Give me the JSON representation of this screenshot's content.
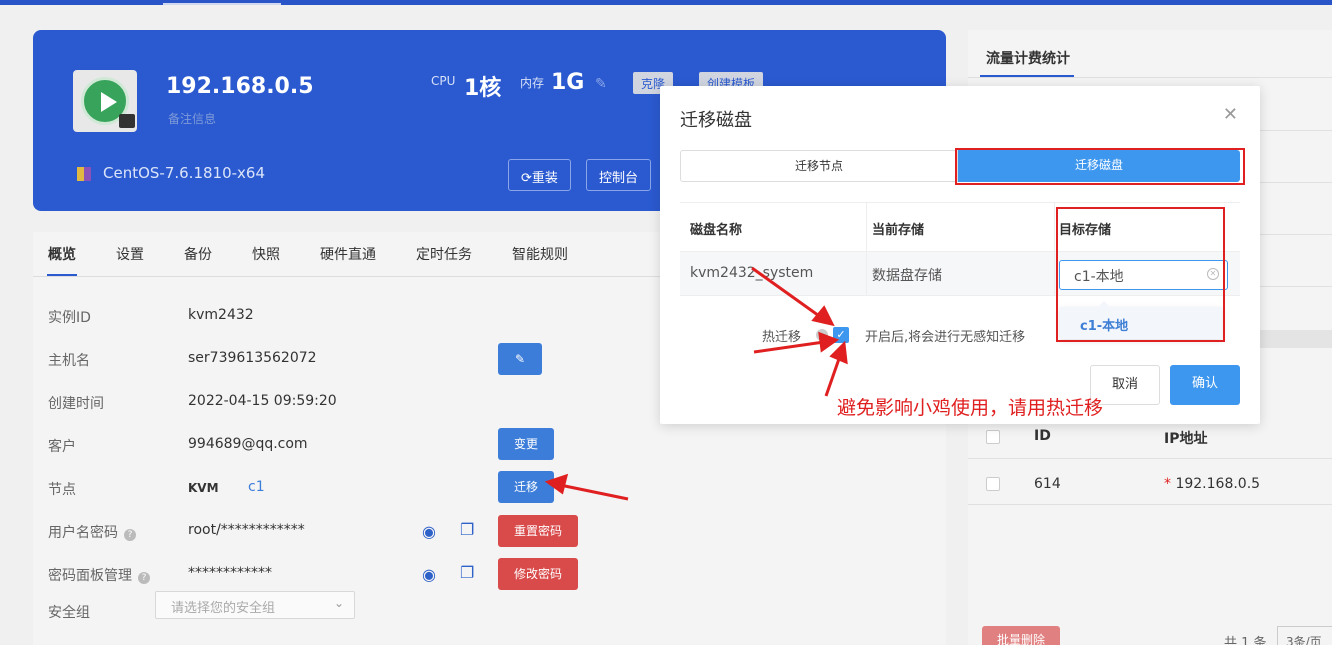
{
  "hero": {
    "ip": "192.168.0.5",
    "remark": "备注信息",
    "cpu_label": "CPU",
    "cpu_value": "1核",
    "mem_label": "内存",
    "mem_value": "1G",
    "pill1": "克隆",
    "pill2": "创建模板",
    "os": "CentOS-7.6.1810-x64",
    "reinstall": "重装",
    "console": "控制台"
  },
  "tabs": [
    "概览",
    "设置",
    "备份",
    "快照",
    "硬件直通",
    "定时任务",
    "智能规则"
  ],
  "info": {
    "instance_id_label": "实例ID",
    "instance_id": "kvm2432",
    "hostname_label": "主机名",
    "hostname": "ser739613562072",
    "created_label": "创建时间",
    "created": "2022-04-15 09:59:20",
    "customer_label": "客户",
    "customer": "994689@qq.com",
    "change_btn": "变更",
    "node_label": "节点",
    "node_type": "KVM",
    "node_name": "c1",
    "migrate_btn": "迁移",
    "userpass_label": "用户名密码",
    "userpass": "root/************",
    "reset_pass_btn": "重置密码",
    "panel_pass_label": "密码面板管理",
    "panel_pass": "************",
    "modify_pass_btn": "修改密码",
    "secgroup_label": "安全组",
    "secgroup_placeholder": "请选择您的安全组"
  },
  "right": {
    "title": "流量计费统计",
    "col_id": "ID",
    "col_ip": "IP地址",
    "row_id": "614",
    "row_ip": "192.168.0.5",
    "batch_delete": "批量删除",
    "total": "共 1 条",
    "pager": "3条/页"
  },
  "modal": {
    "title": "迁移磁盘",
    "tab_node": "迁移节点",
    "tab_disk": "迁移磁盘",
    "col_disk_name": "磁盘名称",
    "col_current": "当前存储",
    "col_target": "目标存储",
    "disk_name": "kvm2432_system",
    "current_storage": "数据盘存储",
    "target_storage": "c1-本地",
    "dropdown_option": "c1-本地",
    "hot_label": "热迁移",
    "hot_desc": "开启后,将会进行无感知迁移",
    "cancel": "取消",
    "confirm": "确认"
  },
  "annotation": "避免影响小鸡使用，请用热迁移",
  "colors": {
    "primary": "#2b5ad0",
    "accent": "#3e97ee",
    "danger": "#e02020"
  }
}
